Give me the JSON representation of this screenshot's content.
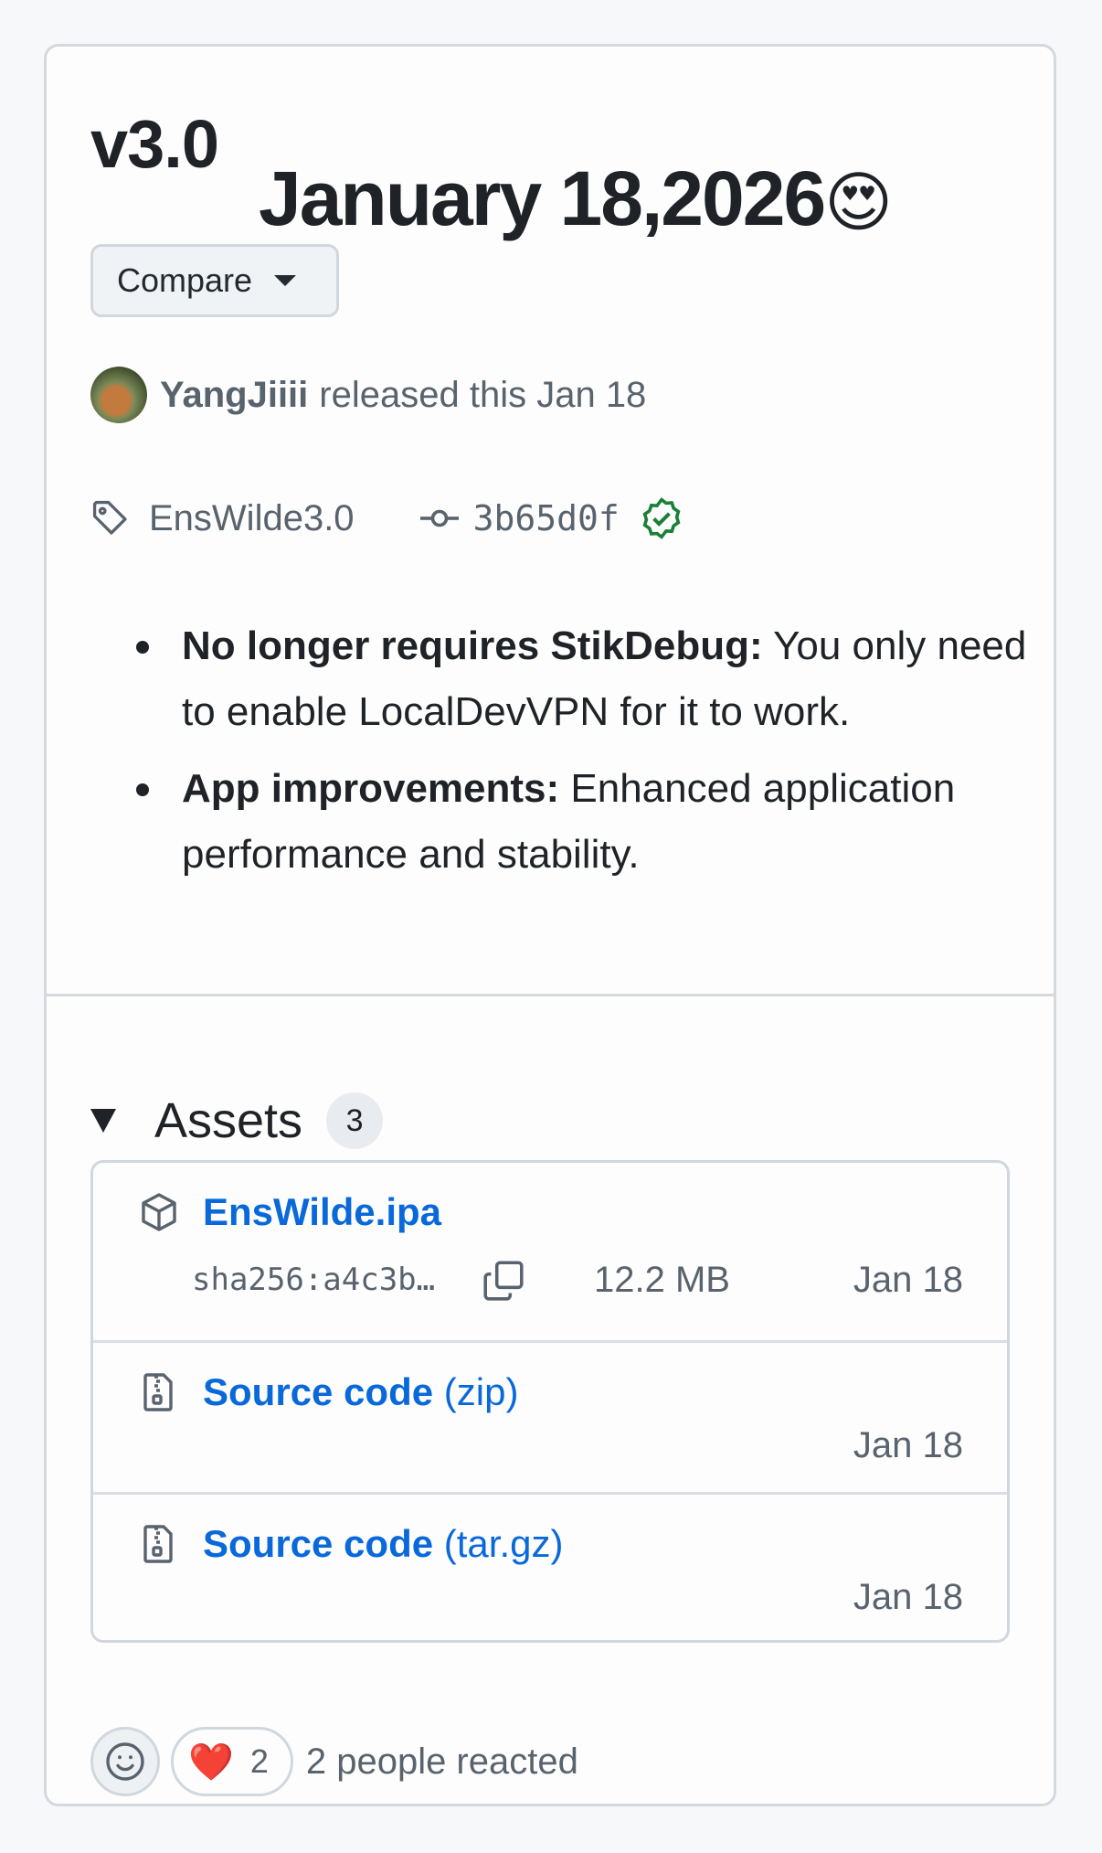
{
  "release": {
    "title": "v3.0",
    "subtitle": "January 18,2026",
    "subtitle_emoji": "😍",
    "compare_label": "Compare",
    "author": "YangJiiii",
    "released_text": "released this Jan 18",
    "tag": "EnsWilde3.0",
    "commit": "3b65d0f"
  },
  "notes": [
    {
      "bold": "No longer requires StikDebug:",
      "text": " You only need to enable LocalDevVPN for it to work."
    },
    {
      "bold": "App improvements:",
      "text": " Enhanced application performance and stability."
    }
  ],
  "assets": {
    "title": "Assets",
    "count": "3",
    "items": [
      {
        "name": "EnsWilde.ipa",
        "ext": "",
        "sha": "sha256:a4c3b…",
        "size": "12.2 MB",
        "date": "Jan 18"
      },
      {
        "name": "Source code",
        "ext": " (zip)",
        "date": "Jan 18"
      },
      {
        "name": "Source code",
        "ext": " (tar.gz)",
        "date": "Jan 18"
      }
    ]
  },
  "reactions": {
    "heart_emoji": "❤️",
    "heart_count": "2",
    "summary": "2 people reacted"
  },
  "colors": {
    "link": "#0969da",
    "verified": "#1a7f37",
    "muted": "#59636e"
  }
}
